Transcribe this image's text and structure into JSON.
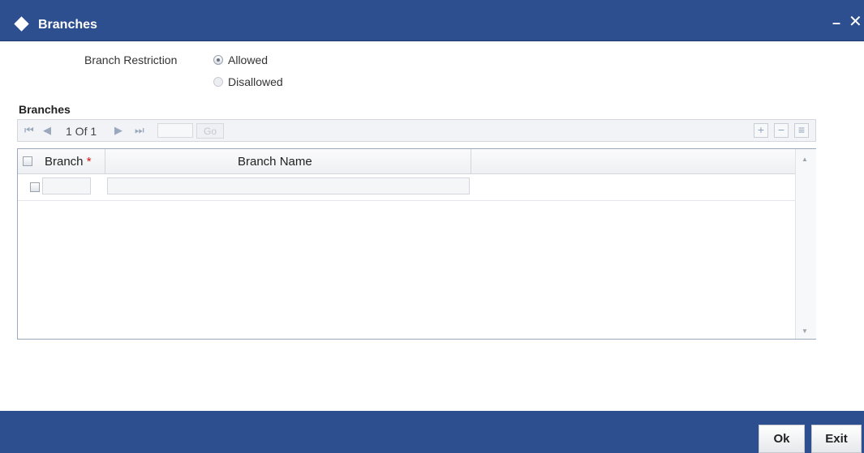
{
  "window": {
    "title": "Branches",
    "minimize_glyph": "–",
    "close_glyph": "✕"
  },
  "restriction": {
    "label": "Branch Restriction",
    "options": [
      {
        "label": "Allowed",
        "selected": true
      },
      {
        "label": "Disallowed",
        "selected": false
      }
    ]
  },
  "branches": {
    "title": "Branches",
    "pager": {
      "first": "⏮",
      "prev": "◀",
      "text": "1 Of 1",
      "next": "▶",
      "last": "⏭",
      "go": "Go"
    },
    "actions": {
      "add": "+",
      "remove": "−",
      "view": "≡"
    },
    "columns": [
      {
        "label": "Branch",
        "required": "*"
      },
      {
        "label": "Branch Name"
      }
    ],
    "rows": [
      {
        "branch": "",
        "branch_name": ""
      }
    ]
  },
  "footer": {
    "ok": "Ok",
    "exit": "Exit"
  },
  "colors": {
    "brand": "#2e4f8f",
    "required": "#dd1111"
  }
}
